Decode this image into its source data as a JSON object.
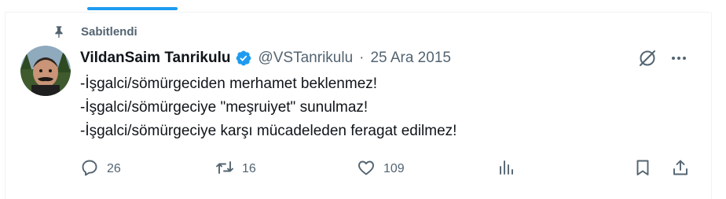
{
  "pinned": {
    "label": "Sabitlendi"
  },
  "tweet": {
    "display_name": "VildanSaim Tanrikulu",
    "handle": "@VSTanrikulu",
    "separator": "·",
    "date": "25 Ara 2015",
    "lines": [
      "-İşgalci/sömürgeciden merhamet beklenmez!",
      "-İşgalci/sömürgeciye \"meşruiyet\" sunulmaz!",
      "-İşgalci/sömürgeciye karşı mücadeleden feragat edilmez!"
    ]
  },
  "actions": {
    "replies": "26",
    "retweets": "16",
    "likes": "109"
  },
  "icons": {
    "pin": "pin-icon",
    "verified": "verified-badge-icon",
    "grok": "grok-icon",
    "more": "more-icon",
    "reply": "reply-icon",
    "retweet": "retweet-icon",
    "like": "heart-icon",
    "views": "views-icon",
    "bookmark": "bookmark-icon",
    "share": "share-icon"
  },
  "colors": {
    "accent": "#1d9bf0",
    "text_primary": "#0f1419",
    "text_secondary": "#536471",
    "border": "#eff3f4"
  }
}
